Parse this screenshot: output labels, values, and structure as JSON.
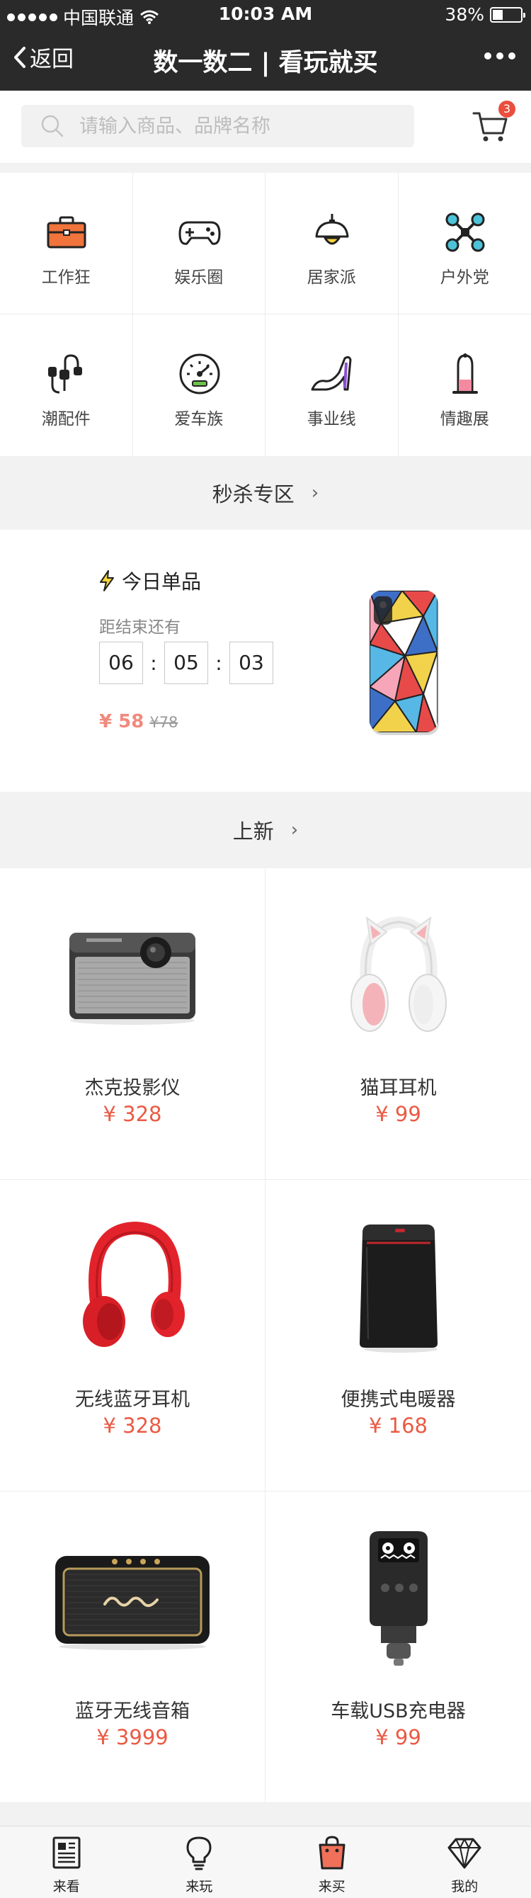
{
  "status_bar": {
    "carrier": "中国联通",
    "time": "10:03 AM",
    "battery": "38%",
    "battery_level": 0.38
  },
  "nav": {
    "back_label": "返回",
    "title": "数一数二 | 看玩就买"
  },
  "search": {
    "placeholder": "请输入商品、品牌名称",
    "cart_count": "3"
  },
  "categories": [
    {
      "label": "工作狂",
      "icon": "briefcase-icon"
    },
    {
      "label": "娱乐圈",
      "icon": "gamepad-icon"
    },
    {
      "label": "居家派",
      "icon": "lamp-icon"
    },
    {
      "label": "户外党",
      "icon": "drone-icon"
    },
    {
      "label": "潮配件",
      "icon": "headphones-icon"
    },
    {
      "label": "爱车族",
      "icon": "speedometer-icon"
    },
    {
      "label": "事业线",
      "icon": "high-heel-icon"
    },
    {
      "label": "情趣展",
      "icon": "condom-icon"
    }
  ],
  "flash_sale": {
    "section_title": "秒杀专区",
    "title": "今日单品",
    "subtitle": "距结束还有",
    "hours": "06",
    "minutes": "05",
    "seconds": "03",
    "price": "¥ 58",
    "original_price": "¥78",
    "image": "phone-case-image"
  },
  "new_arrivals": {
    "section_title": "上新",
    "products": [
      {
        "name": "杰克投影仪",
        "price": "¥ 328",
        "image": "projector-image"
      },
      {
        "name": "猫耳耳机",
        "price": "¥ 99",
        "image": "cat-ear-headphones-image"
      },
      {
        "name": "无线蓝牙耳机",
        "price": "¥ 328",
        "image": "red-headphones-image"
      },
      {
        "name": "便携式电暖器",
        "price": "¥ 168",
        "image": "heater-image"
      },
      {
        "name": "蓝牙无线音箱",
        "price": "¥ 3999",
        "image": "marshall-speaker-image"
      },
      {
        "name": "车载USB充电器",
        "price": "¥ 99",
        "image": "car-charger-image"
      }
    ]
  },
  "tabbar": [
    {
      "label": "来看",
      "icon": "newspaper-icon"
    },
    {
      "label": "来玩",
      "icon": "lightbulb-icon"
    },
    {
      "label": "来买",
      "icon": "shopping-bag-icon"
    },
    {
      "label": "我的",
      "icon": "diamond-icon"
    }
  ],
  "colors": {
    "nav_bg": "#2a2a2a",
    "accent_price": "#ea5a44",
    "badge": "#ea4e3d"
  }
}
